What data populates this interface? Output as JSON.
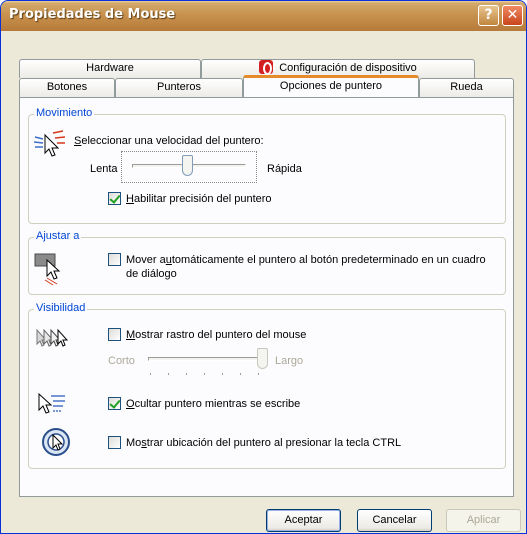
{
  "window": {
    "title": "Propiedades de Mouse",
    "help_glyph": "?",
    "close_glyph": "✕"
  },
  "tabs": {
    "row1": [
      {
        "label": "Hardware"
      },
      {
        "label": "Configuración de dispositivo",
        "icon": "synaptics-icon"
      }
    ],
    "row2": [
      {
        "label": "Botones"
      },
      {
        "label": "Punteros"
      },
      {
        "label": "Opciones de puntero",
        "active": true
      },
      {
        "label": "Rueda"
      }
    ]
  },
  "movimiento": {
    "legend": "Movimiento",
    "speed_label_a": "S",
    "speed_label_b": "eleccionar una velocidad del puntero:",
    "slow": "Lenta",
    "fast": "Rápida",
    "speed_value_fraction": 0.48,
    "precision_a": "H",
    "precision_b": "abilitar precisión del puntero",
    "precision_checked": true
  },
  "ajustar": {
    "legend": "Ajustar a",
    "snap_a": "Mover a",
    "snap_u": "u",
    "snap_b": "tomáticamente el puntero al botón predeterminado en un cuadro",
    "snap_line2": "de diálogo",
    "snap_checked": false
  },
  "visibilidad": {
    "legend": "Visibilidad",
    "trails_u": "M",
    "trails_b": "ostrar rastro del puntero del mouse",
    "trails_checked": false,
    "short": "Corto",
    "long": "Largo",
    "trails_value_fraction": 1.0,
    "hide_u": "O",
    "hide_b": "cultar puntero mientras se escribe",
    "hide_checked": true,
    "ctrl_a": "Mo",
    "ctrl_u": "s",
    "ctrl_b": "trar ubicación del puntero al presionar la tecla CTRL",
    "ctrl_checked": false
  },
  "buttons": {
    "ok": "Aceptar",
    "cancel": "Cancelar",
    "apply": "Aplicar"
  }
}
